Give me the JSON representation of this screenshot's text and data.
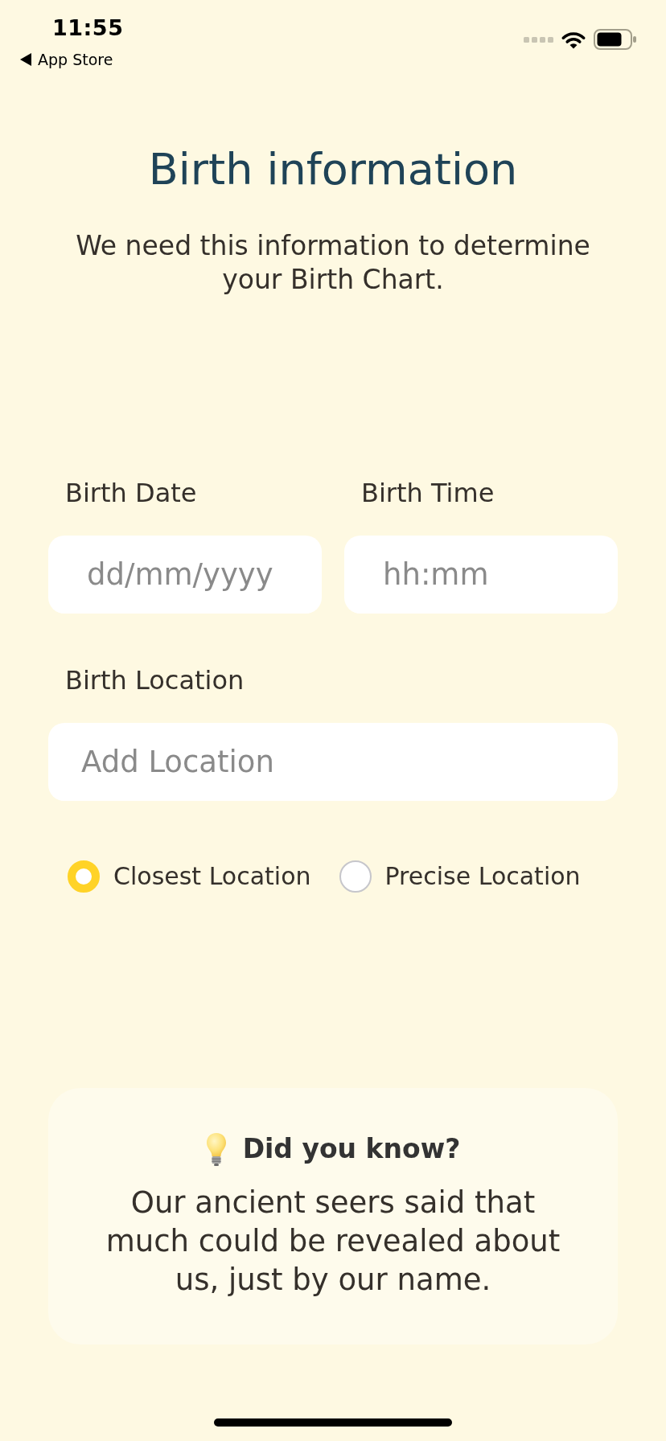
{
  "status_bar": {
    "time": "11:55",
    "back_label": "App Store"
  },
  "header": {
    "title": "Birth information",
    "subtitle": "We need this information to determine your Birth Chart."
  },
  "date_time_fields": [
    {
      "label": "Birth Date",
      "placeholder": "dd/mm/yyyy"
    },
    {
      "label": "Birth Time",
      "placeholder": "hh:mm"
    }
  ],
  "location_field": {
    "label": "Birth Location",
    "placeholder": "Add Location"
  },
  "location_options": [
    {
      "label": "Closest Location",
      "selected": true
    },
    {
      "label": "Precise Location",
      "selected": false
    }
  ],
  "tip_card": {
    "title": "Did you know?",
    "body": "Our ancient seers said that much could be revealed about us, just by our name."
  }
}
